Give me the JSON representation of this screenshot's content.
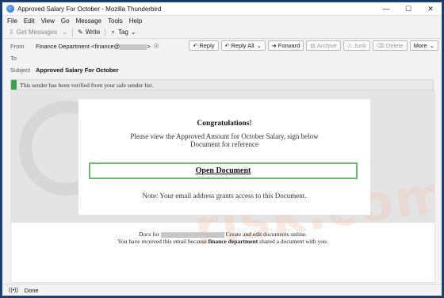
{
  "window": {
    "title": "Approved Salary For October - Mozilla Thunderbird"
  },
  "menu": [
    "File",
    "Edit",
    "View",
    "Go",
    "Message",
    "Tools",
    "Help"
  ],
  "toolbar": {
    "get_messages": "Get Messages",
    "write": "Write",
    "tag": "Tag"
  },
  "actions": {
    "reply": "Reply",
    "reply_all": "Reply All",
    "forward": "Forward",
    "archive": "Archive",
    "junk": "Junk",
    "delete": "Delete",
    "more": "More"
  },
  "header": {
    "from_label": "From",
    "from_value": "Finance Department <finance@",
    "from_value_end": ">",
    "to_label": "To",
    "subject_label": "Subject",
    "subject_value": "Approved Salary For October"
  },
  "notice": "This sender has been verified from your safe sender list.",
  "email": {
    "heading": "Congratulations!",
    "line1": "Please view the Approved Amount for October Salary, sign below",
    "line2": "Document for reference",
    "button": "Open Document",
    "note": "Note: Your email address grants access to this Document.",
    "footer_prefix": "Docs for",
    "footer_suffix": "Create and edit documents online.",
    "footer_line2_a": "You have received this email because",
    "footer_line2_bold": "finance department",
    "footer_line2_b": "shared a document with you."
  },
  "status": {
    "text": "Done"
  },
  "watermark": "risk.com"
}
